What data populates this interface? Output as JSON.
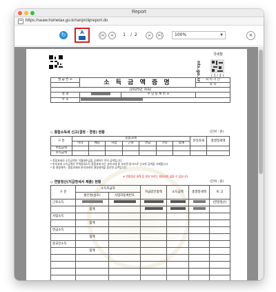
{
  "window": {
    "title": "Report",
    "url": "https://seaw.hometax.go.kr/serp/clipreport.do"
  },
  "toolbar": {
    "refresh_icon": "refresh-icon",
    "print_letter": "A",
    "first_label": "|<",
    "prev_label": "<",
    "current_page": "1",
    "page_sep": "/",
    "total_pages": "2",
    "next_label": ">",
    "last_label": ">|",
    "zoom": "100%",
    "close_label": "×",
    "accent_print_border": "#d81e1e",
    "accent_refresh": "#2e8fd6"
  },
  "document": {
    "seal_label": "국세청",
    "page_count": "( 1 / 2 )",
    "side_logo": "nts.go.kr",
    "header": {
      "issue_no_label": "발 급 번 호",
      "title": "소 득 금 액 증 명",
      "period_label": "처 리 기 간",
      "period_value": "즉 시",
      "year_note": "(2025년 귀속)",
      "name_label": "성 명",
      "rrn_label": "주 민 등 록 번 호",
      "address_label": "주 소"
    },
    "section1": {
      "title": "◇ 종합소득세 신고(결정 · 경정) 현황",
      "unit": "(단위 : 원)",
      "group_label": "종합과세",
      "col_kind": "구 분",
      "cols": [
        "이자",
        "배당",
        "사업",
        "근로",
        "연금",
        "기타",
        "합계"
      ],
      "col_separate": "분리과세",
      "col_total": "총결정세액",
      "rows": [
        "수입금액",
        "소득금액"
      ]
    },
    "notes": [
      "* 종합과세의 소득금액은 이월결손금을 공제하기 전의 금액입니다.",
      "* 분리과세 소득금액은 주택임대소득 종합과세 또는 분리과세 중 유리한 방식으로 신고한 금액을 기재합니다.",
      "* 총 결정세액 : 종합과세와 분리과세의 결정세액을 합산한 금액입니다."
    ],
    "notes_red": "※ 연말정산 내역 등 일부 자료는 제공되지 않을 수 있습니다.",
    "section2": {
      "title": "◇ 연말정산(지급명세서 제출) 현황",
      "unit": "(단위 : 원)",
      "col_kind": "구 분",
      "col_payer": "소득지급자",
      "col_payer_name": "법인명(상호)",
      "col_biz_no": "사업자등록번호",
      "col_income": "지급받은총액",
      "col_amount": "소득금액",
      "col_tax": "총결정세액",
      "col_note": "비 고",
      "rows": [
        {
          "kind": "근로소득",
          "note": "(연말정산)"
        },
        {
          "kind": "",
          "note": ""
        },
        {
          "kind": "사업소득",
          "note": ""
        },
        {
          "kind": "",
          "note": ""
        },
        {
          "kind": "연금소득",
          "note": ""
        },
        {
          "kind": "",
          "note": ""
        },
        {
          "kind": "종교인소득",
          "note": ""
        },
        {
          "kind": "",
          "note": ""
        }
      ],
      "total_label": "합계"
    }
  }
}
